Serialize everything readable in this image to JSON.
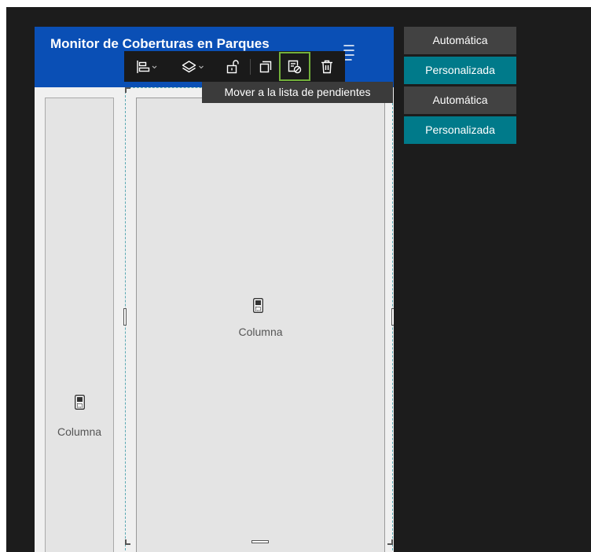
{
  "header": {
    "title": "Monitor de Coberturas en Parques"
  },
  "toolbar": {
    "buttons": [
      {
        "name": "align",
        "icon": "align-left-icon",
        "has_dropdown": true
      },
      {
        "name": "layers",
        "icon": "layers-icon",
        "has_dropdown": true
      },
      {
        "name": "lock",
        "icon": "unlock-icon"
      },
      {
        "name": "duplicate",
        "icon": "duplicate-icon"
      },
      {
        "name": "move-to-pending",
        "icon": "move-to-pending-icon",
        "highlighted": true
      },
      {
        "name": "delete",
        "icon": "trash-icon"
      }
    ]
  },
  "tooltip": {
    "text": "Mover a la lista de pendientes"
  },
  "canvas": {
    "columns": [
      {
        "label": "Columna"
      },
      {
        "label": "Columna"
      }
    ]
  },
  "options": [
    {
      "label": "Automática"
    },
    {
      "label": "Personalizada"
    },
    {
      "label": "Automática"
    },
    {
      "label": "Personalizada"
    }
  ],
  "colors": {
    "header": "#0a4fb5",
    "custom_option": "#007a8a",
    "auto_option": "#424242",
    "highlight": "#73b03b",
    "selection": "#5aa8b3"
  }
}
